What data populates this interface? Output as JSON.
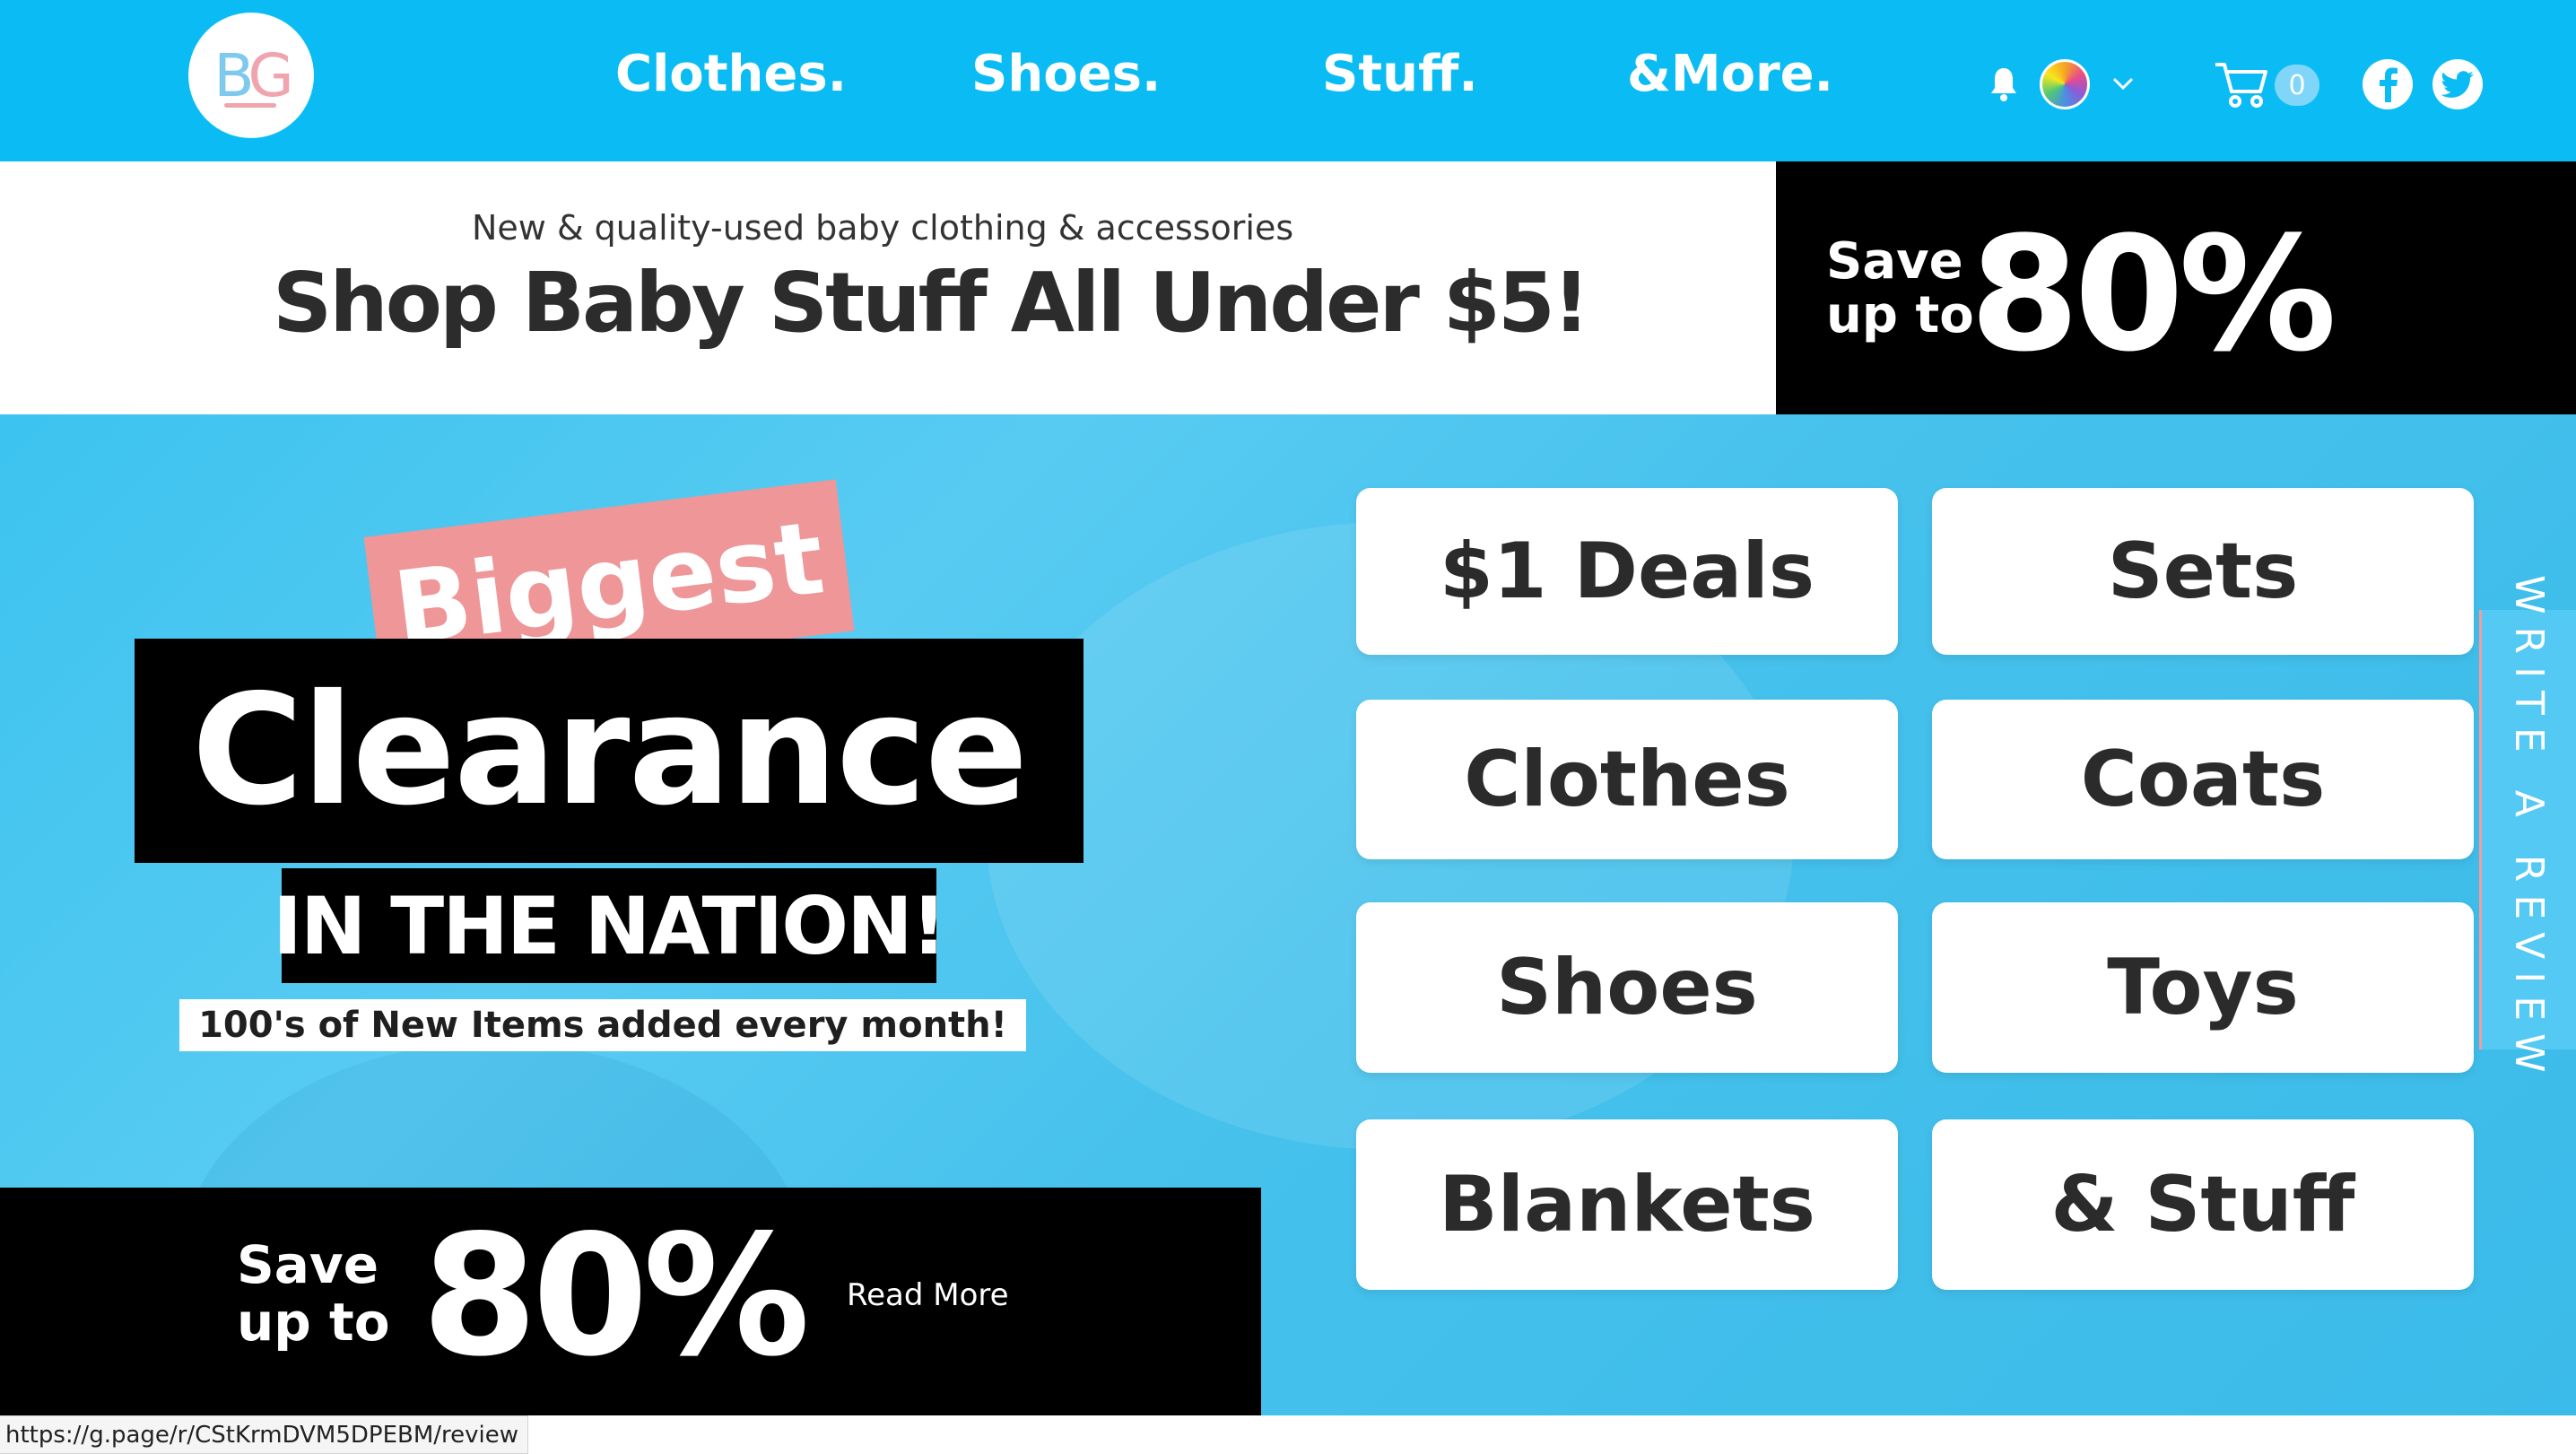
{
  "header": {
    "logo": {
      "text_b": "B",
      "text_g": "G",
      "colors": {
        "b": "#7ec9ee",
        "g": "#f0a4ae"
      }
    },
    "nav": [
      {
        "label": "Clothes."
      },
      {
        "label": "Shoes."
      },
      {
        "label": "Stuff."
      },
      {
        "label": "&More."
      }
    ],
    "icons": {
      "bell": "bell-icon",
      "language": "language-flag-icon",
      "language_chevron": "chevron-down-icon",
      "cart": "cart-icon",
      "facebook": "facebook-icon",
      "twitter": "twitter-icon"
    },
    "cart_count": "0",
    "background_color": "#0bbcf4"
  },
  "subbanner": {
    "tagline": "New & quality-used baby clothing & accessories",
    "headline": "Shop Baby Stuff All Under $5!",
    "save_label_line1": "Save",
    "save_label_line2": "up to",
    "save_percent": "80%"
  },
  "hero": {
    "badge": "Biggest",
    "headline": "Clearance",
    "subheadline": "IN THE NATION!",
    "note": "100's of New Items added every month!",
    "save_label_line1": "Save",
    "save_label_line2": "up to",
    "save_percent": "80%",
    "read_more": "Read More",
    "accent_pink": "#ef9698"
  },
  "categories": [
    {
      "label": "$1 Deals"
    },
    {
      "label": "Sets"
    },
    {
      "label": "Clothes"
    },
    {
      "label": "Coats"
    },
    {
      "label": "Shoes"
    },
    {
      "label": "Toys"
    },
    {
      "label": "Blankets"
    },
    {
      "label": "& Stuff"
    }
  ],
  "review_tab": {
    "label": "WRITE A REVIEW"
  },
  "status_bar": {
    "url": "https://g.page/r/CStKrmDVM5DPEBM/review"
  }
}
